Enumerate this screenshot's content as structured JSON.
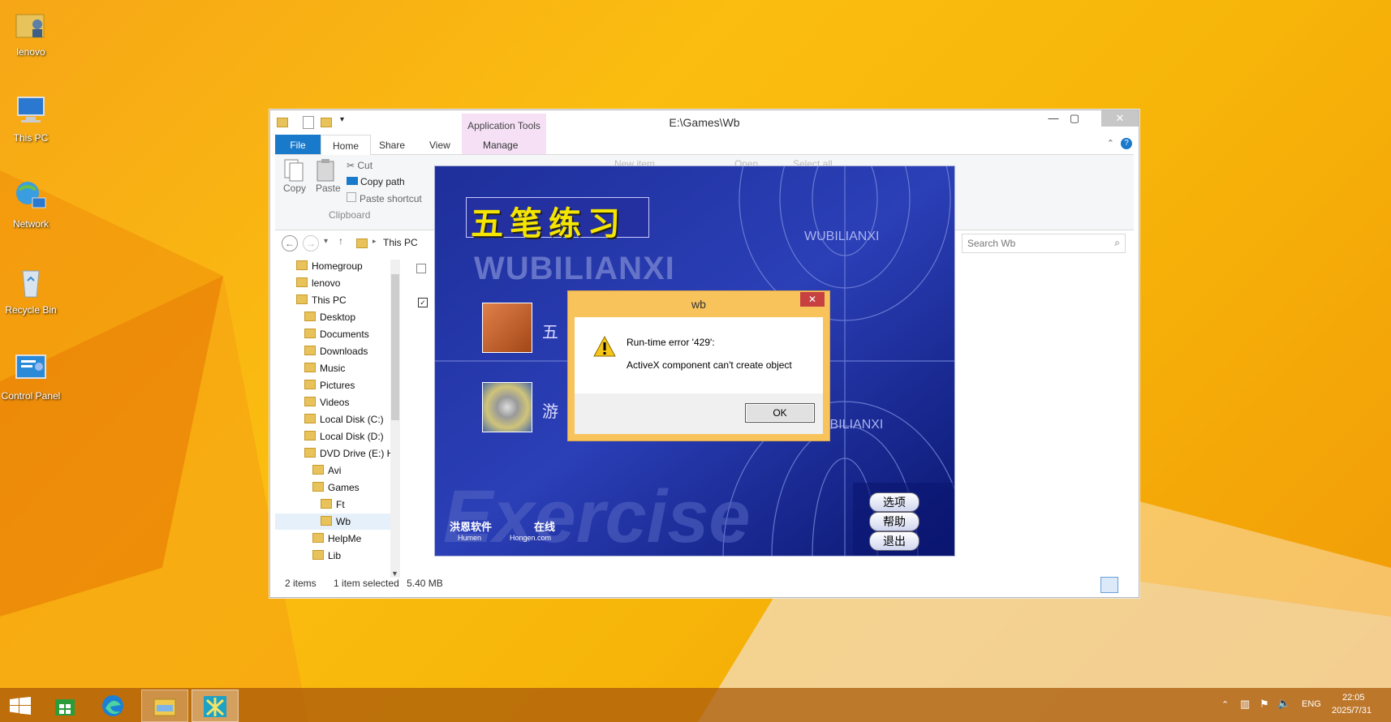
{
  "desktop": {
    "icons": [
      {
        "label": "lenovo"
      },
      {
        "label": "This PC"
      },
      {
        "label": "Network"
      },
      {
        "label": "Recycle Bin"
      },
      {
        "label": "Control Panel"
      }
    ]
  },
  "explorer": {
    "title": "E:\\Games\\Wb",
    "context_tab": "Application Tools",
    "tabs": [
      "File",
      "Home",
      "Share",
      "View",
      "Manage"
    ],
    "ribbon": {
      "copy": "Copy",
      "paste": "Paste",
      "cut": "Cut",
      "copy_path": "Copy path",
      "paste_shortcut": "Paste shortcut",
      "group_clipboard": "Clipboard",
      "new_item": "New item",
      "open": "Open",
      "select_all": "Select all"
    },
    "address": "This PC",
    "search_placeholder": "Search Wb",
    "nav": [
      {
        "label": "Homegroup",
        "level": 0
      },
      {
        "label": "lenovo",
        "level": 0
      },
      {
        "label": "This PC",
        "level": 0
      },
      {
        "label": "Desktop",
        "level": 1
      },
      {
        "label": "Documents",
        "level": 1
      },
      {
        "label": "Downloads",
        "level": 1
      },
      {
        "label": "Music",
        "level": 1
      },
      {
        "label": "Pictures",
        "level": 1
      },
      {
        "label": "Videos",
        "level": 1
      },
      {
        "label": "Local Disk (C:)",
        "level": 1
      },
      {
        "label": "Local Disk (D:)",
        "level": 1
      },
      {
        "label": "DVD Drive (E:) H",
        "level": 1
      },
      {
        "label": "Avi",
        "level": 2
      },
      {
        "label": "Games",
        "level": 2
      },
      {
        "label": "Ft",
        "level": 3
      },
      {
        "label": "Wb",
        "level": 3
      },
      {
        "label": "HelpMe",
        "level": 2
      },
      {
        "label": "Lib",
        "level": 2
      }
    ],
    "status": {
      "items": "2 items",
      "selected": "1 item selected",
      "size": "5.40 MB"
    }
  },
  "app": {
    "title_cn": "五笔练习",
    "brand_en": "WUBILIANXI",
    "brand_en_small": "WUBILIANXI",
    "brand_en_small2": "UBILIANXI",
    "item1": "五",
    "item2": "游",
    "watermark": "Exercise",
    "menu": [
      "选项",
      "帮助",
      "退出"
    ],
    "footer_left": "洪恩软件",
    "footer_left_en": "Humen",
    "footer_right": "在线",
    "footer_right_en": "Hongen.com"
  },
  "dialog": {
    "title": "wb",
    "line1": "Run-time error '429':",
    "line2": "ActiveX component can't create object",
    "ok": "OK"
  },
  "taskbar": {
    "lang": "ENG",
    "time": "22:05",
    "date": "2025/7/31"
  },
  "colors": {
    "accent": "#1979ca",
    "dialog_frame": "#f9c35c",
    "app_bg": "#0a1b78",
    "close_red": "#c74141"
  }
}
